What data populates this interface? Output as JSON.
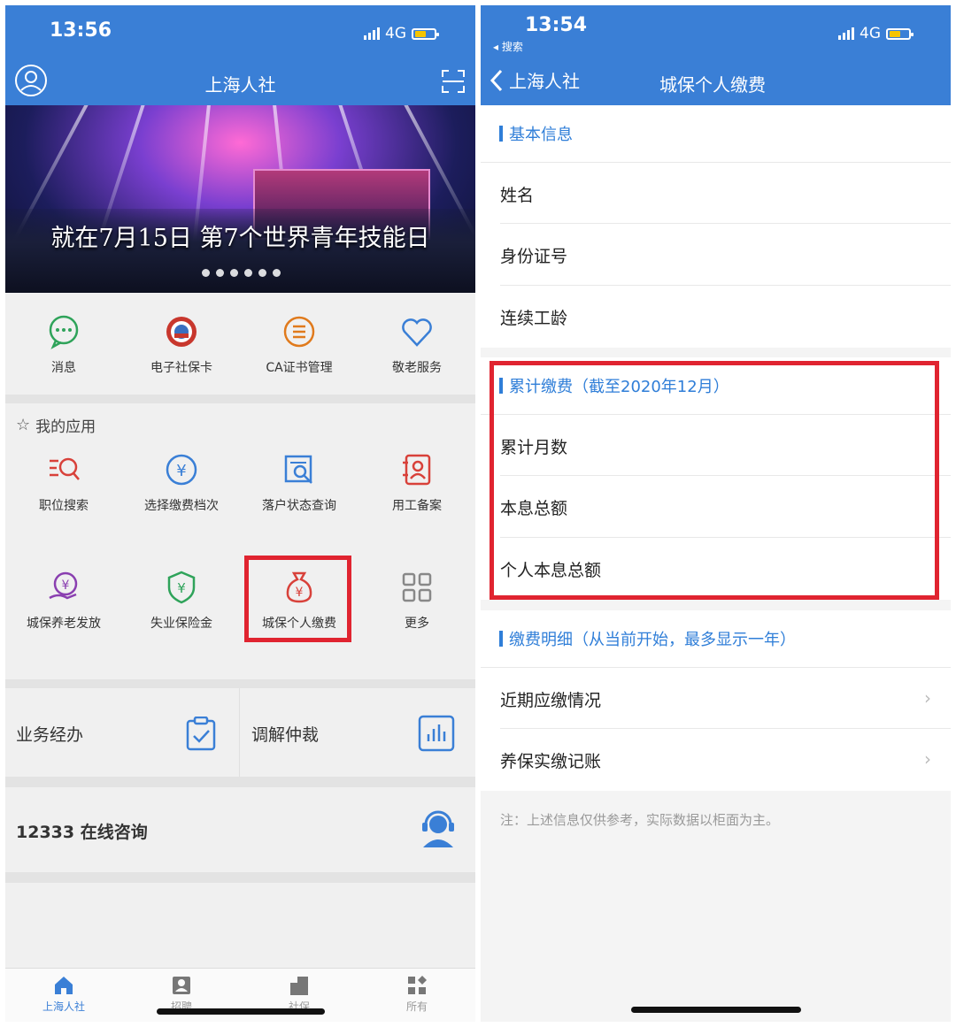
{
  "left": {
    "status": {
      "time": "13:56",
      "network": "4G"
    },
    "header": {
      "title": "上海人社"
    },
    "banner": {
      "caption": "就在7月15日 第7个世界青年技能日"
    },
    "quick_items": [
      {
        "label": "消息",
        "icon": "message-icon"
      },
      {
        "label": "电子社保卡",
        "icon": "social-security-card-icon"
      },
      {
        "label": "CA证书管理",
        "icon": "ca-certificate-icon"
      },
      {
        "label": "敬老服务",
        "icon": "heart-icon"
      }
    ],
    "my_apps": {
      "title": "我的应用",
      "items": [
        {
          "label": "职位搜索",
          "icon": "job-search-icon"
        },
        {
          "label": "选择缴费档次",
          "icon": "yuan-circle-icon"
        },
        {
          "label": "落户状态查询",
          "icon": "document-search-icon"
        },
        {
          "label": "用工备案",
          "icon": "employment-record-icon"
        },
        {
          "label": "城保养老发放",
          "icon": "pension-payout-icon"
        },
        {
          "label": "失业保险金",
          "icon": "shield-yuan-icon"
        },
        {
          "label": "城保个人缴费",
          "icon": "money-bag-icon"
        },
        {
          "label": "更多",
          "icon": "grid-more-icon"
        }
      ]
    },
    "business": {
      "left_label": "业务经办",
      "right_label": "调解仲裁"
    },
    "consult": {
      "label": "12333 在线咨询"
    },
    "tabs": [
      {
        "label": "上海人社",
        "icon": "home-icon",
        "active": true
      },
      {
        "label": "招聘",
        "icon": "badge-icon",
        "active": false
      },
      {
        "label": "社保",
        "icon": "building-icon",
        "active": false
      },
      {
        "label": "所有",
        "icon": "apps-icon",
        "active": false
      }
    ],
    "colors": {
      "brand": "#3a7fd6",
      "highlight": "#e02430"
    }
  },
  "right": {
    "status": {
      "time": "13:54",
      "back_app": "◂ 搜索",
      "network": "4G"
    },
    "header": {
      "back_label": "上海人社",
      "title": "城保个人缴费"
    },
    "basic": {
      "title": "基本信息",
      "rows": [
        "姓名",
        "身份证号",
        "连续工龄"
      ]
    },
    "cumulative": {
      "title": "累计缴费（截至2020年12月）",
      "rows": [
        "累计月数",
        "本息总额",
        "个人本息总额"
      ]
    },
    "details": {
      "title": "缴费明细（从当前开始，最多显示一年）",
      "rows": [
        "近期应缴情况",
        "养保实缴记账"
      ]
    },
    "note": "注：上述信息仅供参考，实际数据以柜面为主。"
  }
}
